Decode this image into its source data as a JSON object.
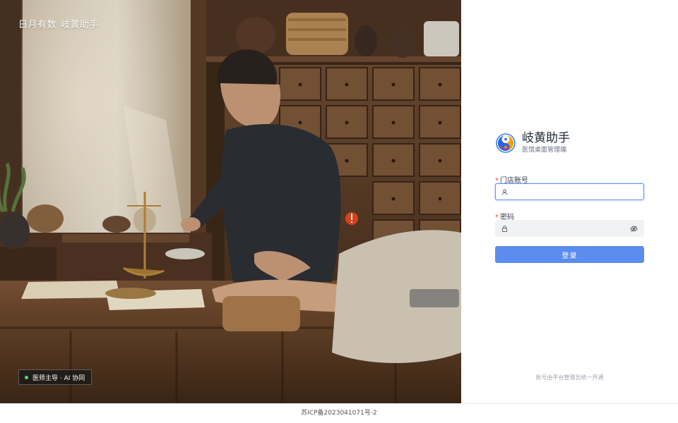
{
  "hero": {
    "brand_left": "日月有数",
    "brand_right": "岐黄助手",
    "badge_text": "医师主导 · AI 协同"
  },
  "app": {
    "name": "岐黄助手",
    "subtitle": "医馆桌面管理端"
  },
  "form": {
    "account_label": "门店账号",
    "account_value": "",
    "password_label": "密码",
    "password_value": "",
    "required_mark": "*",
    "submit_label": "登录"
  },
  "panel_note": "账号由平台管理员统一开通",
  "footer": {
    "icp": "苏ICP备2023041071号-2"
  },
  "colors": {
    "primary": "#5b8def",
    "required": "#ef4444",
    "status_dot": "#4ade80"
  },
  "icons": {
    "account": "user-icon",
    "password": "lock-icon",
    "visibility": "eye-off-icon",
    "logo": "taiji-logo"
  }
}
